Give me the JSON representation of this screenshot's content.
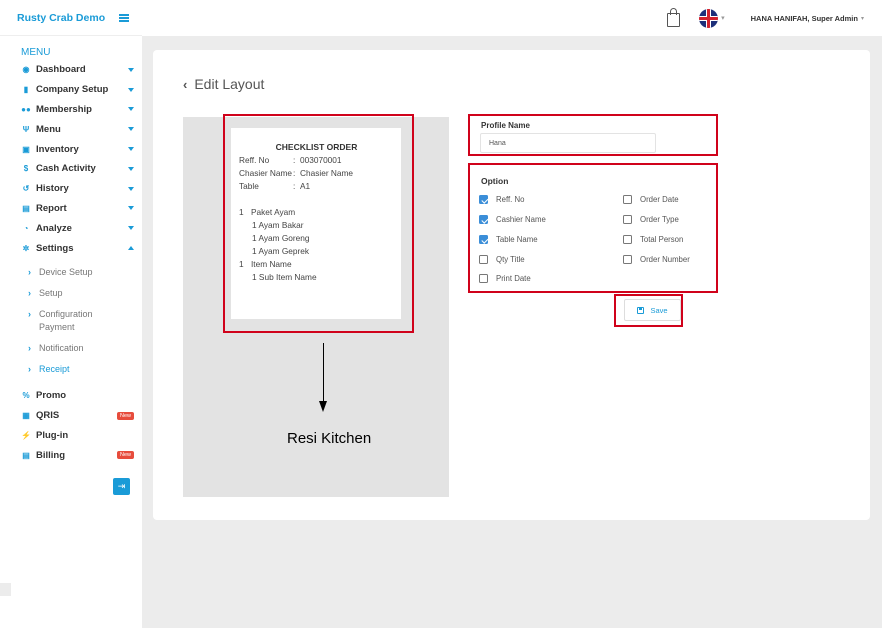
{
  "app": {
    "brand": "Rusty Crab Demo"
  },
  "header": {
    "user_name": "HANA HANIFAH, Super Admin"
  },
  "sidebar": {
    "menu_title": "MENU",
    "items": [
      {
        "label": "Dashboard",
        "icon": "dashboard-icon"
      },
      {
        "label": "Company Setup",
        "icon": "building-icon"
      },
      {
        "label": "Membership",
        "icon": "users-icon"
      },
      {
        "label": "Menu",
        "icon": "utensils-icon"
      },
      {
        "label": "Inventory",
        "icon": "box-icon"
      },
      {
        "label": "Cash Activity",
        "icon": "dollar-icon"
      },
      {
        "label": "History",
        "icon": "history-icon"
      },
      {
        "label": "Report",
        "icon": "file-icon"
      },
      {
        "label": "Analyze",
        "icon": "chart-pie-icon"
      },
      {
        "label": "Settings",
        "icon": "gear-icon"
      }
    ],
    "settings_sub": [
      {
        "label": "Device Setup"
      },
      {
        "label": "Setup"
      },
      {
        "label": "Configuration Payment"
      },
      {
        "label": "Notification"
      },
      {
        "label": "Receipt"
      }
    ],
    "bottom_items": [
      {
        "label": "Promo",
        "icon": "percent-icon"
      },
      {
        "label": "QRIS",
        "icon": "qrcode-icon",
        "badge": "New"
      },
      {
        "label": "Plug-in",
        "icon": "plug-icon"
      },
      {
        "label": "Billing",
        "icon": "file-invoice-icon",
        "badge": "New"
      }
    ]
  },
  "page": {
    "title": "Edit Layout"
  },
  "receipt": {
    "title": "CHECKLIST ORDER",
    "fields": [
      {
        "key": "Reff. No",
        "sep": ":",
        "value": "003070001"
      },
      {
        "key": "Chasier Name",
        "sep": ":",
        "value": "Chasier Name"
      },
      {
        "key": "Table",
        "sep": ":",
        "value": "A1"
      }
    ],
    "items": [
      {
        "qty": "1",
        "name": "Paket Ayam",
        "subs": [
          "1 Ayam Bakar",
          "1 Ayam Goreng",
          "1 Ayam Geprek"
        ]
      },
      {
        "qty": "1",
        "name": "Item Name",
        "subs": [
          "1 Sub Item Name"
        ]
      }
    ]
  },
  "annotation": {
    "label": "Resi Kitchen"
  },
  "profile": {
    "label": "Profile Name",
    "value": "Hana"
  },
  "options": {
    "label": "Option",
    "items": [
      {
        "label": "Reff. No",
        "checked": true
      },
      {
        "label": "Cashier Name",
        "checked": true
      },
      {
        "label": "Table Name",
        "checked": true
      },
      {
        "label": "Qty Title",
        "checked": false
      },
      {
        "label": "Print Date",
        "checked": false
      },
      {
        "label": "Order Date",
        "checked": false
      },
      {
        "label": "Order Type",
        "checked": false
      },
      {
        "label": "Total Person",
        "checked": false
      },
      {
        "label": "Order Number",
        "checked": false
      }
    ]
  },
  "actions": {
    "save_label": "Save"
  },
  "colors": {
    "accent": "#1a9bd7",
    "highlight": "#d0021b",
    "checkbox": "#3b8ed8"
  }
}
